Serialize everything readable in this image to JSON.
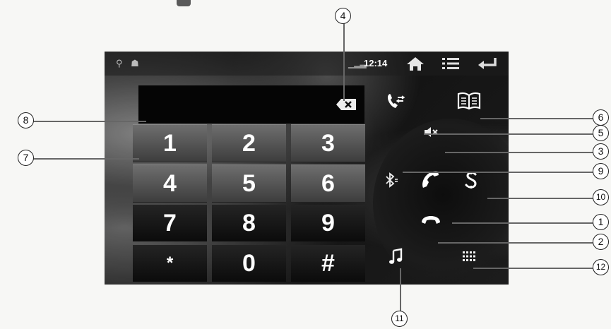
{
  "status_bar": {
    "time": "12:14",
    "icons": [
      "usb-icon",
      "android-icon",
      "signal-icon",
      "home-icon",
      "menu-icon",
      "back-icon"
    ]
  },
  "dialer": {
    "display_value": "",
    "keys": [
      "1",
      "2",
      "3",
      "4",
      "5",
      "6",
      "7",
      "8",
      "9",
      "*",
      "0",
      "#"
    ]
  },
  "controls": {
    "icons": [
      "backspace-icon",
      "call-transfer-icon",
      "phonebook-icon",
      "mute-icon",
      "bluetooth-icon",
      "answer-call-icon",
      "settings-s-icon",
      "hang-up-icon",
      "music-icon",
      "keypad-icon"
    ]
  },
  "callouts": {
    "c1": "1",
    "c2": "2",
    "c3": "3",
    "c4": "4",
    "c5": "5",
    "c6": "6",
    "c7": "7",
    "c8": "8",
    "c9": "9",
    "c10": "10",
    "c11": "11",
    "c12": "12"
  }
}
